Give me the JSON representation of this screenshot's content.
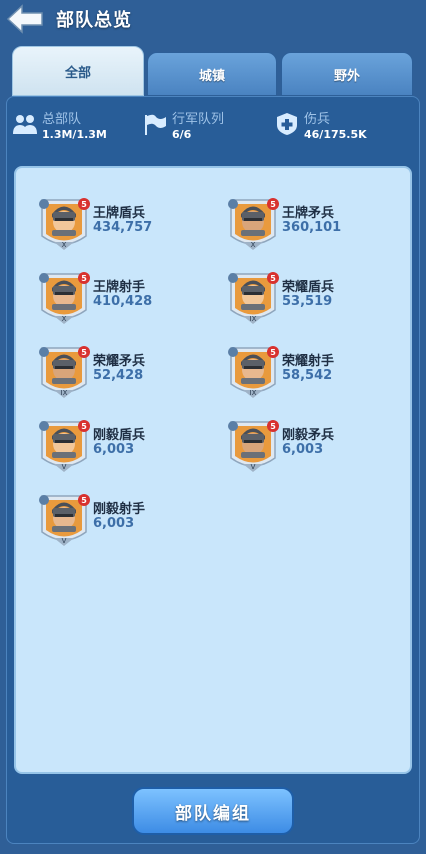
{
  "header": {
    "title": "部队总览",
    "back_icon": "back-arrow-icon"
  },
  "tabs": [
    {
      "label": "全部",
      "active": true
    },
    {
      "label": "城镇",
      "active": false
    },
    {
      "label": "野外",
      "active": false
    }
  ],
  "stats": [
    {
      "icon": "troops-icon",
      "label": "总部队",
      "value": "1.3M/1.3M"
    },
    {
      "icon": "flag-icon",
      "label": "行军队列",
      "value": "6/6"
    },
    {
      "icon": "medical-cross-icon",
      "label": "伤兵",
      "value": "46/175.5K"
    }
  ],
  "units": [
    {
      "name": "王牌盾兵",
      "count": "434,757",
      "tier": "X",
      "level": "5",
      "class_icon": "shield-class-icon"
    },
    {
      "name": "王牌矛兵",
      "count": "360,101",
      "tier": "X",
      "level": "5",
      "class_icon": "spear-class-icon"
    },
    {
      "name": "王牌射手",
      "count": "410,428",
      "tier": "X",
      "level": "5",
      "class_icon": "bow-class-icon"
    },
    {
      "name": "荣耀盾兵",
      "count": "53,519",
      "tier": "IX",
      "level": "5",
      "class_icon": "shield-class-icon"
    },
    {
      "name": "荣耀矛兵",
      "count": "52,428",
      "tier": "IX",
      "level": "5",
      "class_icon": "spear-class-icon"
    },
    {
      "name": "荣耀射手",
      "count": "58,542",
      "tier": "IX",
      "level": "5",
      "class_icon": "bow-class-icon"
    },
    {
      "name": "刚毅盾兵",
      "count": "6,003",
      "tier": "V",
      "level": "5",
      "class_icon": "shield-class-icon"
    },
    {
      "name": "刚毅矛兵",
      "count": "6,003",
      "tier": "V",
      "level": "5",
      "class_icon": "spear-class-icon"
    },
    {
      "name": "刚毅射手",
      "count": "6,003",
      "tier": "V",
      "level": "5",
      "class_icon": "bow-class-icon"
    }
  ],
  "footer": {
    "button_label": "部队编组"
  },
  "colors": {
    "panel": "#285d98",
    "list_bg": "#c9e6fb",
    "accent": "#3d8ce5",
    "level_badge": "#d8322f"
  }
}
